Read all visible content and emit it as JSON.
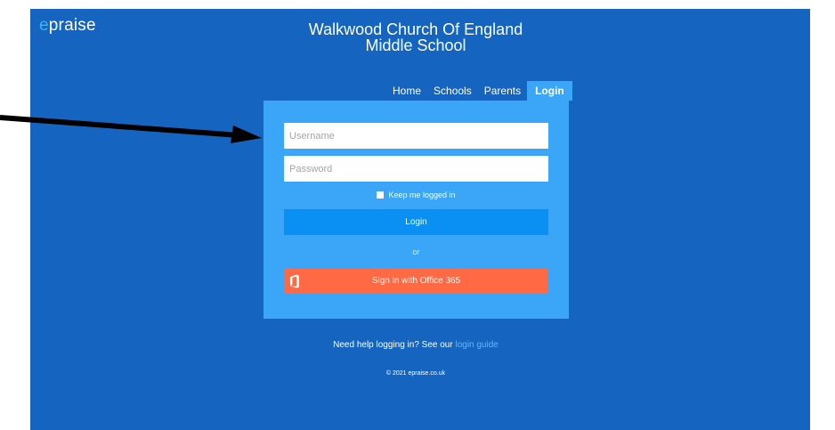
{
  "header": {
    "logo_accent": "e",
    "logo_rest": "praise",
    "title_line1": "Walkwood Church Of England",
    "title_line2": "Middle School"
  },
  "nav": {
    "items": [
      {
        "label": "Home"
      },
      {
        "label": "Schools"
      },
      {
        "label": "Parents"
      },
      {
        "label": "Login"
      }
    ],
    "active": "Login"
  },
  "login_form": {
    "username_placeholder": "Username",
    "password_placeholder": "Password",
    "keep_logged_in_label": "Keep me logged in",
    "login_button": "Login",
    "or_text": "or",
    "office_button": "Sign in with Office 365"
  },
  "footer": {
    "help_text": "Need help logging in? See our ",
    "help_link": "login guide",
    "copyright": "© 2021 epraise.co.uk"
  },
  "colors": {
    "page_background": "#1565c0",
    "panel": "#3ba5f7",
    "login_button": "#0a8ff2",
    "office_button": "#ff6a44",
    "logo_accent": "#3fb3f5",
    "link": "#64b5f6"
  },
  "annotation": {
    "arrow": "black arrow pointing to the username field"
  }
}
